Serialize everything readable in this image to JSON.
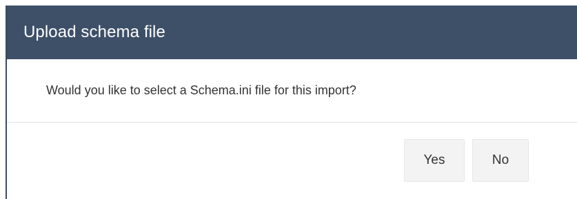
{
  "dialog": {
    "title": "Upload schema file",
    "message": "Would you like to select a Schema.ini file for this import?",
    "buttons": {
      "yes_label": "Yes",
      "no_label": "No"
    }
  },
  "colors": {
    "header_background": "#3e5068",
    "header_text": "#ffffff",
    "button_background": "#f3f3f3"
  }
}
